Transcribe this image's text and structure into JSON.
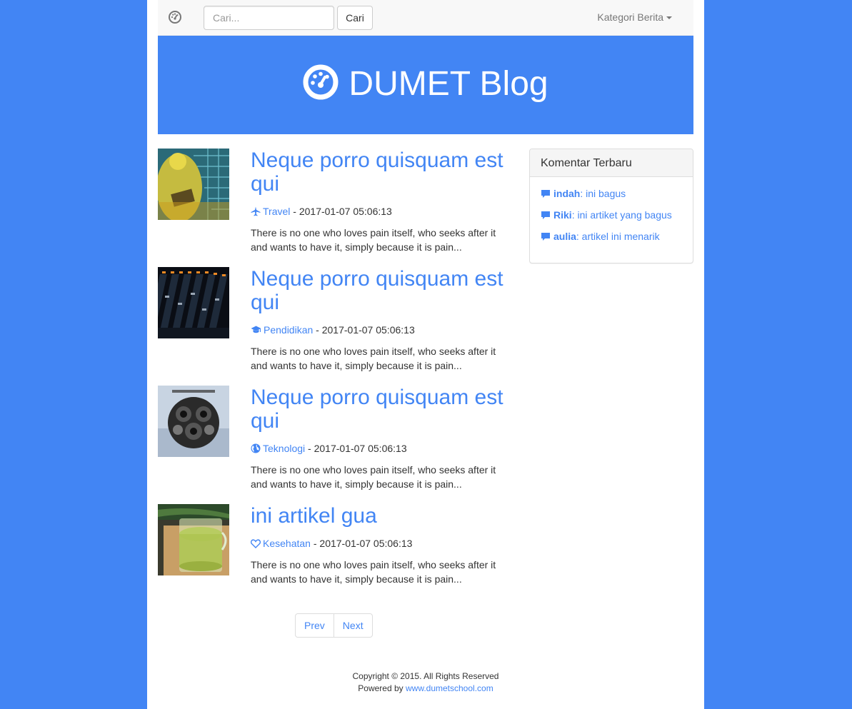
{
  "colors": {
    "accent": "#4285f4",
    "background": "#4285f4",
    "navbar": "#f8f8f8",
    "text": "#333333"
  },
  "navbar": {
    "logo_icon": "dashboard-icon",
    "search_placeholder": "Cari...",
    "search_value": "",
    "search_button": "Cari",
    "category_dropdown": "Kategori Berita"
  },
  "header": {
    "icon": "dashboard-icon",
    "title": "DUMET Blog"
  },
  "articles": [
    {
      "title": "Neque porro quisquam est qui",
      "category": "Travel",
      "category_icon": "plane-icon",
      "datetime": "2017-01-07 05:06:13",
      "excerpt": "There is no one who loves pain itself, who seeks after it and wants to have it, simply because it is pain...",
      "image": "yellow-tech-worker-thumbnail"
    },
    {
      "title": "Neque porro quisquam est qui",
      "category": "Pendidikan",
      "category_icon": "graduation-cap-icon",
      "datetime": "2017-01-07 05:06:13",
      "excerpt": "There is no one who loves pain itself, who seeks after it and wants to have it, simply because it is pain...",
      "image": "audio-mixer-thumbnail"
    },
    {
      "title": "Neque porro quisquam est qui",
      "category": "Teknologi",
      "category_icon": "globe-icon",
      "datetime": "2017-01-07 05:06:13",
      "excerpt": "There is no one who loves pain itself, who seeks after it and wants to have it, simply because it is pain...",
      "image": "speakers-sphere-thumbnail"
    },
    {
      "title": "ini artikel gua",
      "category": "Kesehatan",
      "category_icon": "heart-icon",
      "datetime": "2017-01-07 05:06:13",
      "excerpt": "There is no one who loves pain itself, who seeks after it and wants to have it, simply because it is pain...",
      "image": "green-smoothie-thumbnail"
    }
  ],
  "meta_separator": " - ",
  "pagination": {
    "prev": "Prev",
    "next": "Next"
  },
  "sidebar": {
    "title": "Komentar Terbaru",
    "comments": [
      {
        "author": "indah",
        "text": ": ini bagus"
      },
      {
        "author": "Riki",
        "text": ": ini artiket yang bagus"
      },
      {
        "author": "aulia",
        "text": ": artikel ini menarik"
      }
    ]
  },
  "footer": {
    "copyright": "Copyright © 2015. All Rights Reserved",
    "powered_prefix": "Powered by ",
    "powered_link": "www.dumetschool.com"
  }
}
